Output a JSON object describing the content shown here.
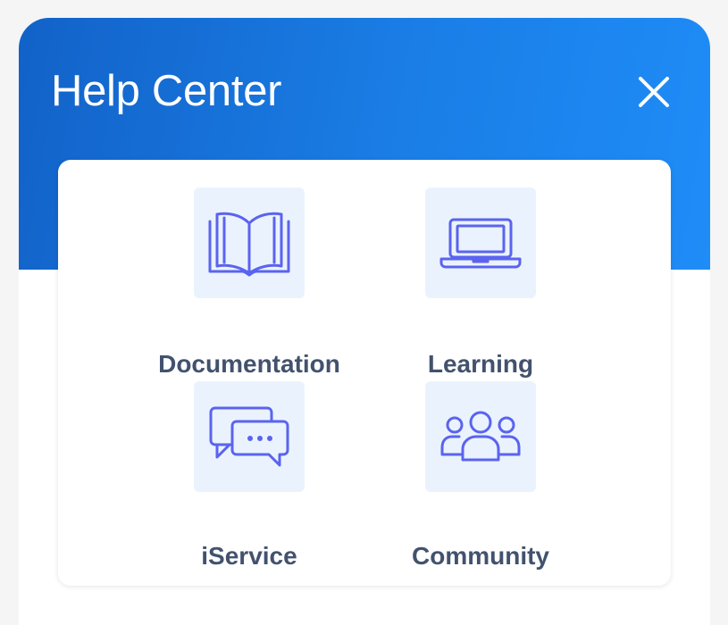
{
  "header": {
    "title": "Help Center",
    "close_icon": "close-icon"
  },
  "colors": {
    "header_gradient_start": "#1262c8",
    "header_gradient_end": "#1f8cf7",
    "icon_stroke": "#5b63f0",
    "icon_tile_bg": "#eaf3fd",
    "label_text": "#42526e"
  },
  "tiles": [
    {
      "label": "Documentation",
      "icon": "open-book-icon"
    },
    {
      "label": "Learning",
      "icon": "laptop-icon"
    },
    {
      "label": "iService",
      "icon": "chat-bubbles-icon"
    },
    {
      "label": "Community",
      "icon": "people-group-icon"
    }
  ]
}
